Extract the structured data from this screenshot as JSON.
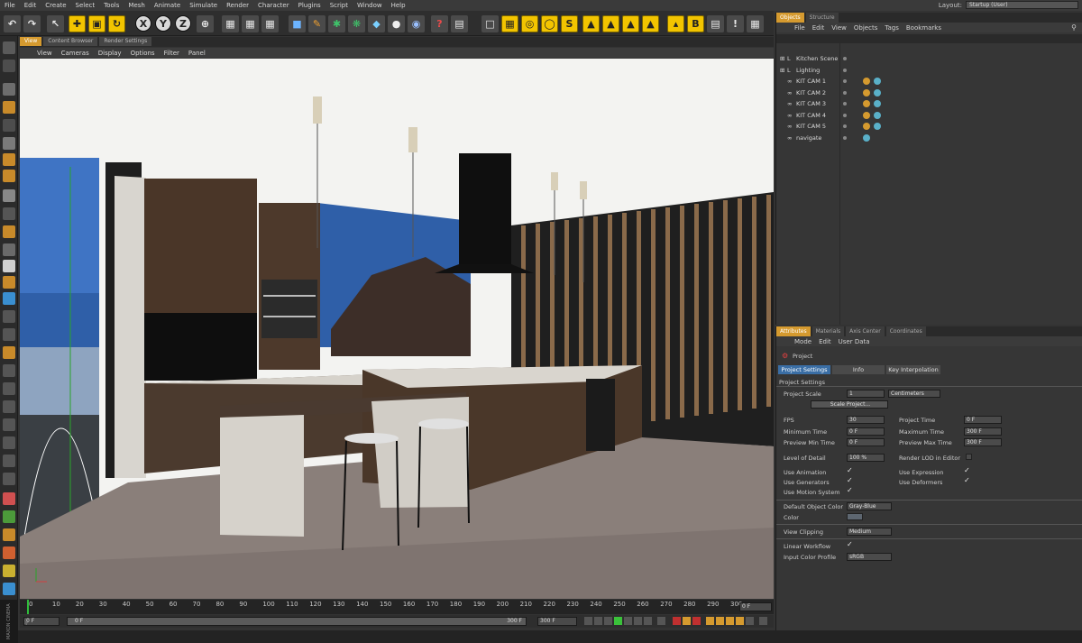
{
  "menu": [
    "File",
    "Edit",
    "Create",
    "Select",
    "Tools",
    "Mesh",
    "Animate",
    "Simulate",
    "Render",
    "Character",
    "Plugins",
    "Script",
    "Window",
    "Help"
  ],
  "layout": {
    "label": "Layout:",
    "value": "Startup (User)"
  },
  "toolbar_coords": [
    "X",
    "Y",
    "Z"
  ],
  "viewport": {
    "tabs": [
      "View",
      "Content Browser",
      "Render Settings"
    ],
    "menu": [
      "View",
      "Cameras",
      "Display",
      "Options",
      "Filter",
      "Panel"
    ]
  },
  "timeline": {
    "ticks": [
      "0",
      "10",
      "20",
      "30",
      "40",
      "50",
      "60",
      "70",
      "80",
      "90",
      "100",
      "110",
      "120",
      "130",
      "140",
      "150",
      "160",
      "170",
      "180",
      "190",
      "200",
      "210",
      "220",
      "230",
      "240",
      "250",
      "260",
      "270",
      "280",
      "290",
      "300"
    ],
    "current_frame": "0 F",
    "start_field": "0 F",
    "end_field": "300 F",
    "range_end": "300 F",
    "playhead_label": "0 F"
  },
  "maxon_label": "MAXON CINEMA 4D",
  "objects_panel": {
    "tabs": [
      "Objects",
      "Structure"
    ],
    "menu": [
      "File",
      "Edit",
      "View",
      "Objects",
      "Tags",
      "Bookmarks"
    ],
    "items": [
      {
        "name": "Kitchen Scene",
        "type": "group"
      },
      {
        "name": "Lighting",
        "type": "group"
      },
      {
        "name": "KIT CAM 1",
        "type": "camera"
      },
      {
        "name": "KIT CAM 2",
        "type": "camera"
      },
      {
        "name": "KIT CAM 3",
        "type": "camera"
      },
      {
        "name": "KIT CAM 4",
        "type": "camera"
      },
      {
        "name": "KIT CAM 5",
        "type": "camera"
      },
      {
        "name": "navigate",
        "type": "camera"
      }
    ]
  },
  "attributes": {
    "tabs": [
      "Attributes",
      "Materials",
      "Axis Center",
      "Coordinates"
    ],
    "menu": [
      "Mode",
      "Edit",
      "User Data"
    ],
    "object_title": "Project",
    "subtabs": [
      "Project Settings",
      "Info",
      "Key Interpolation"
    ],
    "section": "Project Settings",
    "project_scale_label": "Project Scale",
    "project_scale_value": "1",
    "project_scale_unit": "Centimeters",
    "scale_button": "Scale Project...",
    "fps_label": "FPS",
    "fps_value": "30",
    "project_time_label": "Project Time",
    "project_time_value": "0 F",
    "min_time_label": "Minimum Time",
    "min_time_value": "0 F",
    "max_time_label": "Maximum Time",
    "max_time_value": "300 F",
    "prev_min_label": "Preview Min Time",
    "prev_min_value": "0 F",
    "prev_max_label": "Preview Max Time",
    "prev_max_value": "300 F",
    "lod_label": "Level of Detail",
    "lod_value": "100 %",
    "render_lod_label": "Render LOD in Editor",
    "use_animation": "Use Animation",
    "use_expression": "Use Expression",
    "use_generators": "Use Generators",
    "use_deformers": "Use Deformers",
    "use_motion": "Use Motion System",
    "default_color_label": "Default Object Color",
    "default_color_value": "Gray-Blue",
    "color_label": "Color",
    "view_clipping_label": "View Clipping",
    "view_clipping_value": "Medium",
    "linear_workflow_label": "Linear Workflow",
    "input_profile_label": "Input Color Profile",
    "input_profile_value": "sRGB"
  },
  "colors": {
    "accent": "#d59a2f",
    "tool_yellow": "#f2c400",
    "panel": "#363636"
  }
}
